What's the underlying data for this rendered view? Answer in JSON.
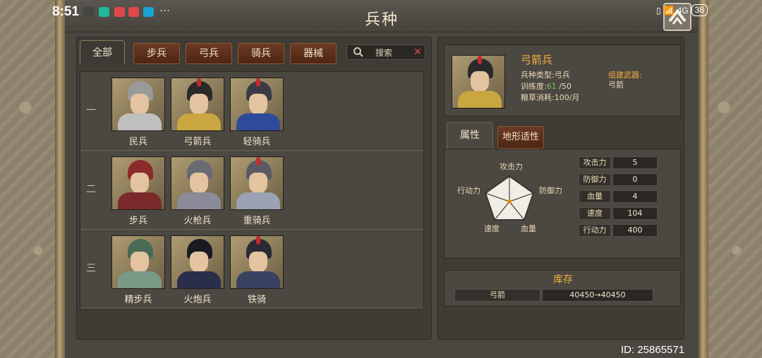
{
  "status_bar": {
    "time": "8:51",
    "battery": "38",
    "network": "4G"
  },
  "header": {
    "title": "兵种"
  },
  "filter": {
    "all_tab": "全部",
    "type_tabs": [
      "步兵",
      "弓兵",
      "骑兵",
      "器械"
    ],
    "search_label": "搜索"
  },
  "tiers": [
    {
      "label": "一",
      "units": [
        {
          "name": "民兵",
          "helmet_color": "#9a9a9a",
          "armor_color": "#bfbfbf"
        },
        {
          "name": "弓箭兵",
          "helmet_color": "#2a2a2a",
          "armor_color": "#c9a640"
        },
        {
          "name": "轻骑兵",
          "helmet_color": "#3a3a46",
          "armor_color": "#2e4a9a"
        }
      ]
    },
    {
      "label": "二",
      "units": [
        {
          "name": "步兵",
          "helmet_color": "#8a2a2a",
          "armor_color": "#7a2a2a"
        },
        {
          "name": "火枪兵",
          "helmet_color": "#6a6a72",
          "armor_color": "#8a8a98"
        },
        {
          "name": "重骑兵",
          "helmet_color": "#5a5a64",
          "armor_color": "#9aa2b4"
        }
      ]
    },
    {
      "label": "三",
      "units": [
        {
          "name": "精步兵",
          "helmet_color": "#4a6a58",
          "armor_color": "#7a9a88"
        },
        {
          "name": "火炮兵",
          "helmet_color": "#1a1a22",
          "armor_color": "#2a2e4a"
        },
        {
          "name": "铁骑",
          "helmet_color": "#2a2a36",
          "armor_color": "#3a4262"
        }
      ]
    }
  ],
  "selected_unit": {
    "name": "弓箭兵",
    "type_line": "兵种类型:弓兵",
    "training_label": "训练度:",
    "training_value": "61",
    "training_max": " /50",
    "food_line": "粮草消耗:100/月",
    "weapon_label": "组建武器:",
    "weapon_value": "弓箭"
  },
  "attr_tabs": {
    "attributes": "属性",
    "terrain": "地形适性"
  },
  "radar": {
    "labels": {
      "attack": "攻击力",
      "defense": "防御力",
      "hp": "血量",
      "speed": "速度",
      "mobility": "行动力"
    }
  },
  "stats": [
    {
      "name": "攻击力",
      "value": "5"
    },
    {
      "name": "防御力",
      "value": "0"
    },
    {
      "name": "血量",
      "value": "4"
    },
    {
      "name": "速度",
      "value": "104"
    },
    {
      "name": "行动力",
      "value": "400"
    }
  ],
  "storage": {
    "title": "库存",
    "item": "弓箭",
    "amount": "40450→40450"
  },
  "player_id": "ID: 25865571",
  "colors": {
    "accent_gold": "#f0b040",
    "tab_brown": "#6b3a24",
    "radar_dot": "#e08a20"
  }
}
